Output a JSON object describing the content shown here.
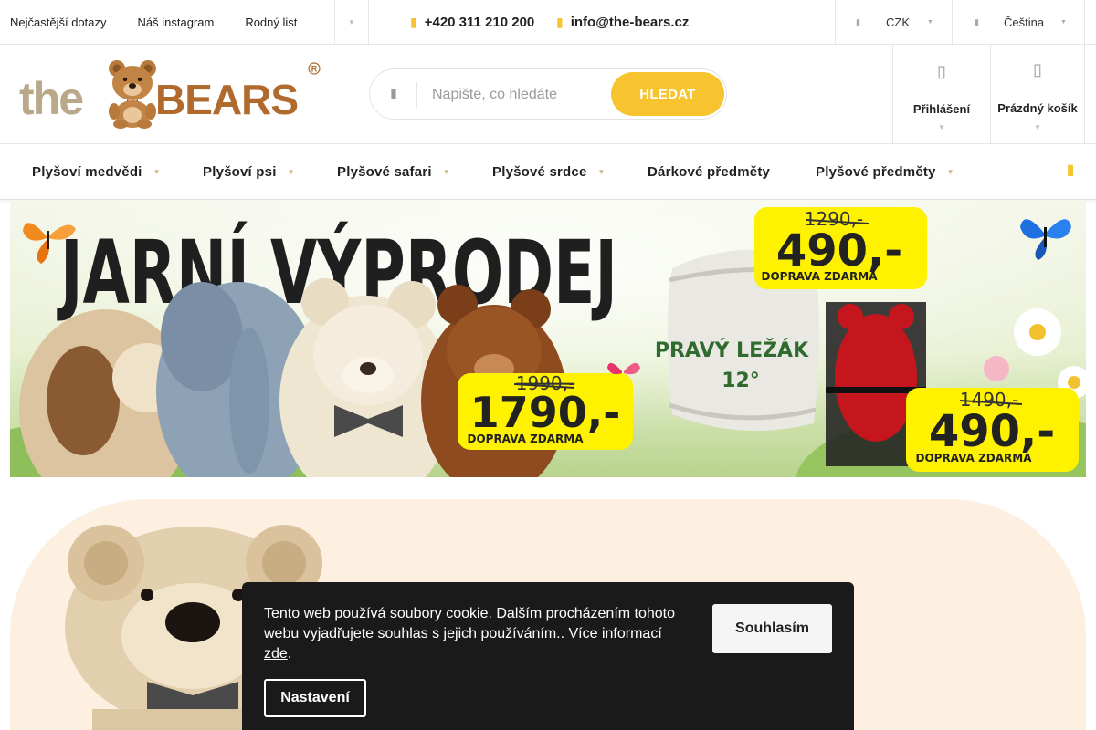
{
  "topbar": {
    "links": [
      "Nejčastější dotazy",
      "Náš instagram",
      "Rodný list"
    ],
    "phone": "+420 311 210 200",
    "email": "info@the-bears.cz",
    "currency": "CZK",
    "language": "Čeština"
  },
  "header": {
    "logo_text": "theBEARS",
    "search_placeholder": "Napište, co hledáte",
    "search_button": "HLEDAT",
    "login_label": "Přihlášení",
    "cart_label": "Prázdný košík"
  },
  "nav": {
    "items": [
      "Plyšoví medvědi",
      "Plyšoví psi",
      "Plyšové safari",
      "Plyšové srdce",
      "Dárkové předměty",
      "Plyšové předměty"
    ]
  },
  "banner": {
    "headline": "JARNÍ VÝPRODEJ",
    "offer1_old": "1290,-",
    "offer1_new": "490,-",
    "offer1_note": "DOPRAVA ZDARMA",
    "offer2_old": "1990,-",
    "offer2_new": "1790,-",
    "offer2_note": "DOPRAVA ZDARMA",
    "offer3_old": "1490,-",
    "offer3_new": "490,-",
    "offer3_note": "DOPRAVA ZDARMA",
    "keg_line1": "PRAVÝ LEŽÁK",
    "keg_line2": "12°"
  },
  "cookie": {
    "text": "Tento web používá soubory cookie. Dalším procházením tohoto webu vyjadřujete souhlas s jejich používáním.. Více informací",
    "link_text": "zde",
    "after_link": ".",
    "agree_button": "Souhlasím",
    "settings_button": "Nastavení"
  },
  "colors": {
    "accent": "#f7c32e",
    "bear_brown": "#b87a3a",
    "dark": "#1a1a1a",
    "hero_bg": "#fdf0e0",
    "price_yellow": "#fef200"
  },
  "icons": [
    "phone-icon",
    "mail-icon",
    "currency-icon",
    "language-icon",
    "search-icon",
    "user-icon",
    "cart-icon",
    "chevron-down-icon"
  ]
}
